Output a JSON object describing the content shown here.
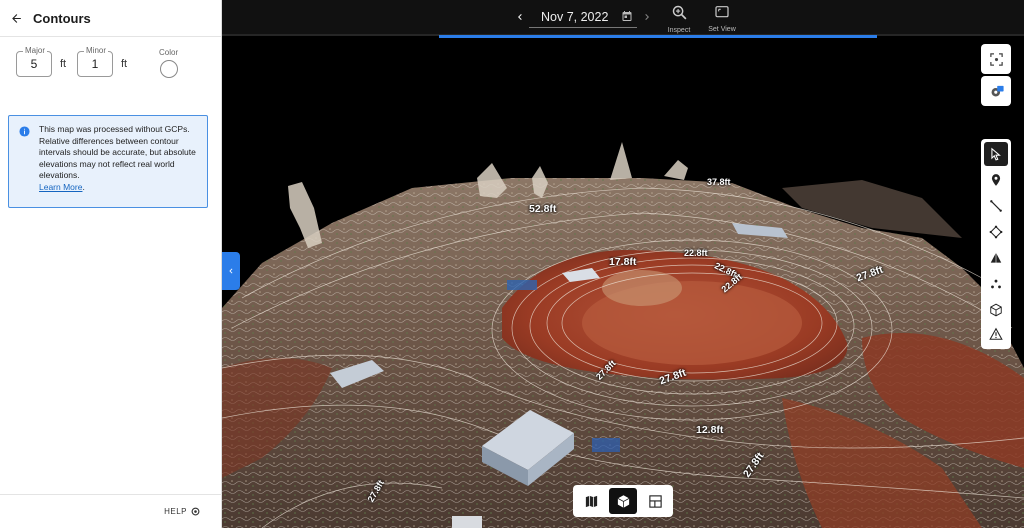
{
  "panel": {
    "title": "Contours",
    "major": {
      "label": "Major",
      "value": "5",
      "unit": "ft"
    },
    "minor": {
      "label": "Minor",
      "value": "1",
      "unit": "ft"
    },
    "color_label": "Color",
    "info": {
      "text": "This map was processed without GCPs. Relative differences between contour intervals should be accurate, but absolute elevations may not reflect real world elevations.",
      "link": "Learn More",
      "after_link": "."
    },
    "help_label": "HELP"
  },
  "topbar": {
    "date": "Nov 7, 2022",
    "inspect_label": "Inspect",
    "set_view_label": "Set View"
  },
  "contour_labels": [
    {
      "text": "52.8ft",
      "rotate": 0
    },
    {
      "text": "37.8ft",
      "rotate": -8
    },
    {
      "text": "22.8ft",
      "rotate": 0
    },
    {
      "text": "17.8ft",
      "rotate": 0
    },
    {
      "text": "22.8ft",
      "rotate": 25
    },
    {
      "text": "22.8ft",
      "rotate": -40
    },
    {
      "text": "27.8ft",
      "rotate": -30
    },
    {
      "text": "27.8ft",
      "rotate": -20
    },
    {
      "text": "27.8ft",
      "rotate": -45
    },
    {
      "text": "12.8ft",
      "rotate": 0
    },
    {
      "text": "27.8ft",
      "rotate": -55
    },
    {
      "text": "27.8ft",
      "rotate": -60
    }
  ],
  "colors": {
    "accent": "#2b7de9",
    "terrain_red": "#9a3b24",
    "panel_info_bg": "#e8f1fc"
  },
  "icons": {
    "back": "arrow-left-icon",
    "info": "info-icon",
    "help": "help-circle-icon",
    "calendar": "calendar-icon",
    "inspect": "zoom-in-icon",
    "set_view": "set-view-icon"
  }
}
